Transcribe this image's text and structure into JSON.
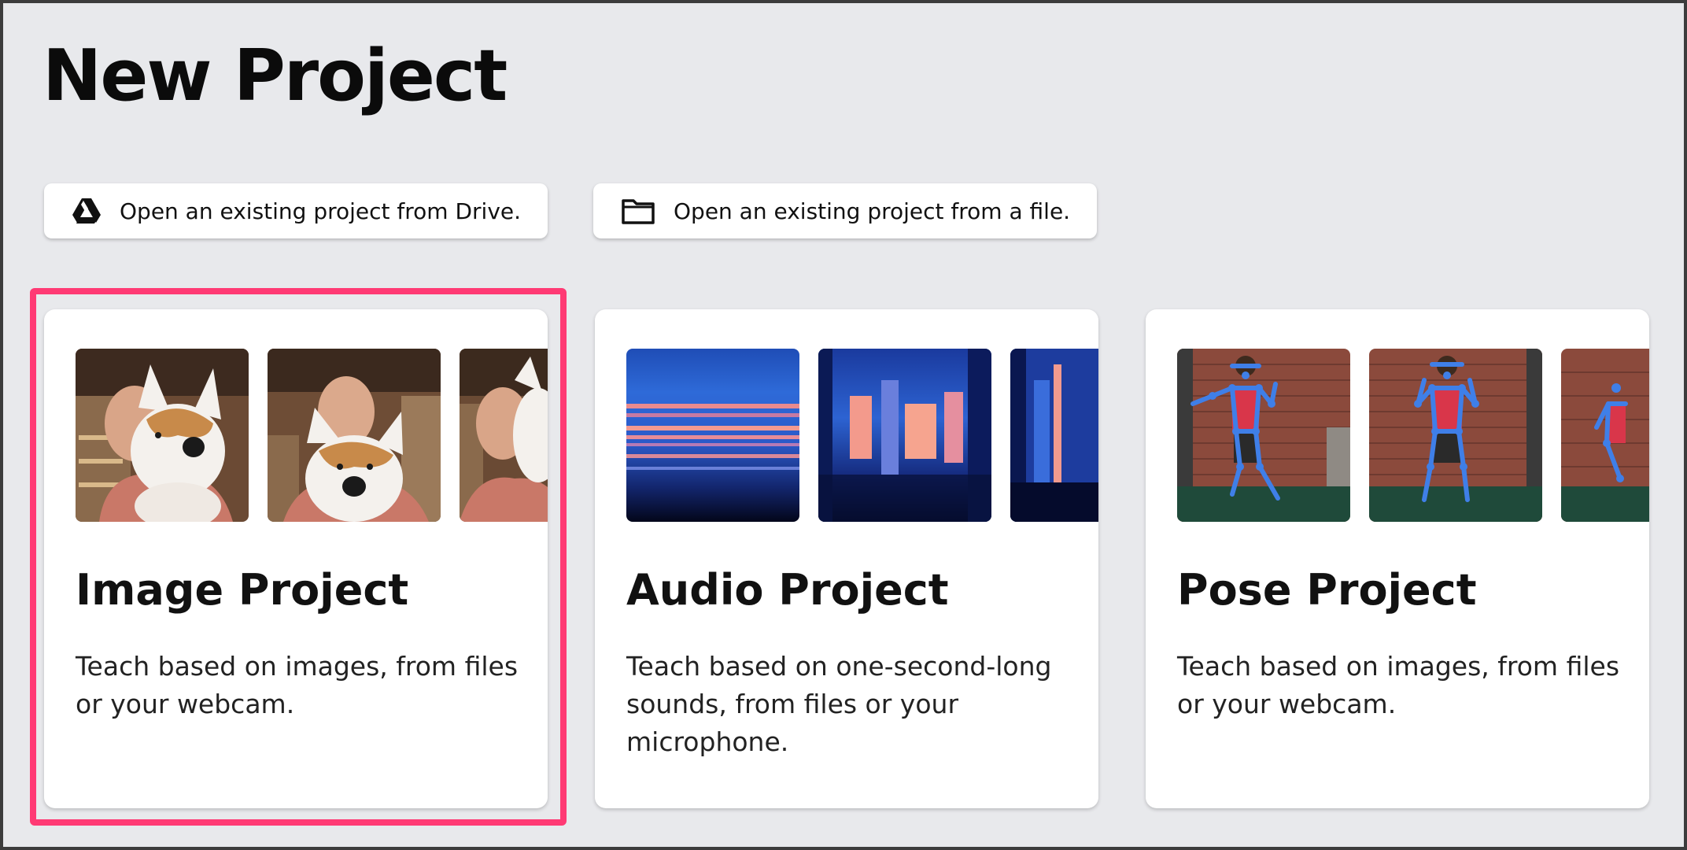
{
  "page": {
    "title": "New Project"
  },
  "open_buttons": {
    "drive": {
      "label": "Open an existing project from Drive.",
      "icon": "google-drive-icon"
    },
    "file": {
      "label": "Open an existing project from a file.",
      "icon": "folder-icon"
    }
  },
  "cards": [
    {
      "title": "Image Project",
      "description": "Teach based on images, from files or your webcam.",
      "selected": true
    },
    {
      "title": "Audio Project",
      "description": "Teach based on one-second-long sounds, from files or your microphone.",
      "selected": false
    },
    {
      "title": "Pose Project",
      "description": "Teach based on images, from files or your webcam.",
      "selected": false
    }
  ],
  "colors": {
    "background": "#e8e9ec",
    "card": "#ffffff",
    "selection_outline": "#ff3a74"
  }
}
